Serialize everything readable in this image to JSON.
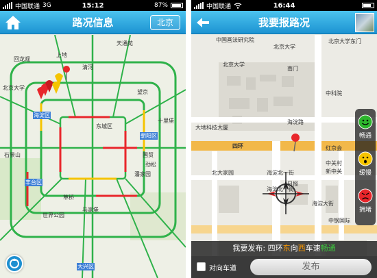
{
  "left_screen": {
    "status": {
      "carrier": "中国联通",
      "network": "3G",
      "time": "15:12",
      "battery": "87%"
    },
    "header": {
      "title": "路况信息",
      "city_button": "北京"
    },
    "map": {
      "labels": {
        "tiantongyuan": "天通苑",
        "shangdi": "上地",
        "beijingdaxue": "北京大学",
        "qinghe": "清河",
        "huilongguan": "回龙观",
        "haidian": "海淀区",
        "chaoyang": "朝阳区",
        "dongcheng": "东城区",
        "fengtai": "丰台区",
        "shijingshan": "石景山",
        "wangjing": "望京",
        "guomao": "国贸",
        "shilipu": "十里堡",
        "panjiayuan": "潘家园",
        "huojingqiao": "劲松",
        "yizhuang": "大兴区",
        "shijiepark": "世界公园",
        "majiapu": "马家堡",
        "caoqiao": "草桥"
      }
    }
  },
  "right_screen": {
    "status": {
      "carrier": "中国联通",
      "time": "16:44",
      "battery": ""
    },
    "header": {
      "title": "我要报路况"
    },
    "map": {
      "labels": {
        "institute": "中国画法研究院",
        "pku": "北京大学",
        "pku_gate": "北京大学东门",
        "pku_sub": "北京大学",
        "nanmen": "南门",
        "zhongguancun_street": "海淀路",
        "sihuan": "四环",
        "haidian_north": "海淀北一街",
        "haidian_south": "海淀大街",
        "dahe_building": "大地科技大厦",
        "xueyuan": "中科院",
        "zhongguancun": "中关村",
        "xinzhongguan": "新中关",
        "beidajiayuan": "北大家园",
        "fengtai": "中钢国际",
        "haidianbeiyijie": "海淀北一街",
        "sanmen": "日报",
        "hongjiahuiliao": "红京会"
      },
      "legend": [
        {
          "label": "畅通",
          "color": "#2db52d"
        },
        {
          "label": "缓慢",
          "color": "#f5c400"
        },
        {
          "label": "拥堵",
          "color": "#e8262b"
        }
      ]
    },
    "report": {
      "prefix": "我要发布: 四环",
      "dir1": "东",
      "mid1": "向",
      "dir2": "西",
      "mid2": "车速",
      "status": "畅通"
    },
    "footer": {
      "opposite_lane": "对向车道",
      "submit": "发布"
    }
  }
}
